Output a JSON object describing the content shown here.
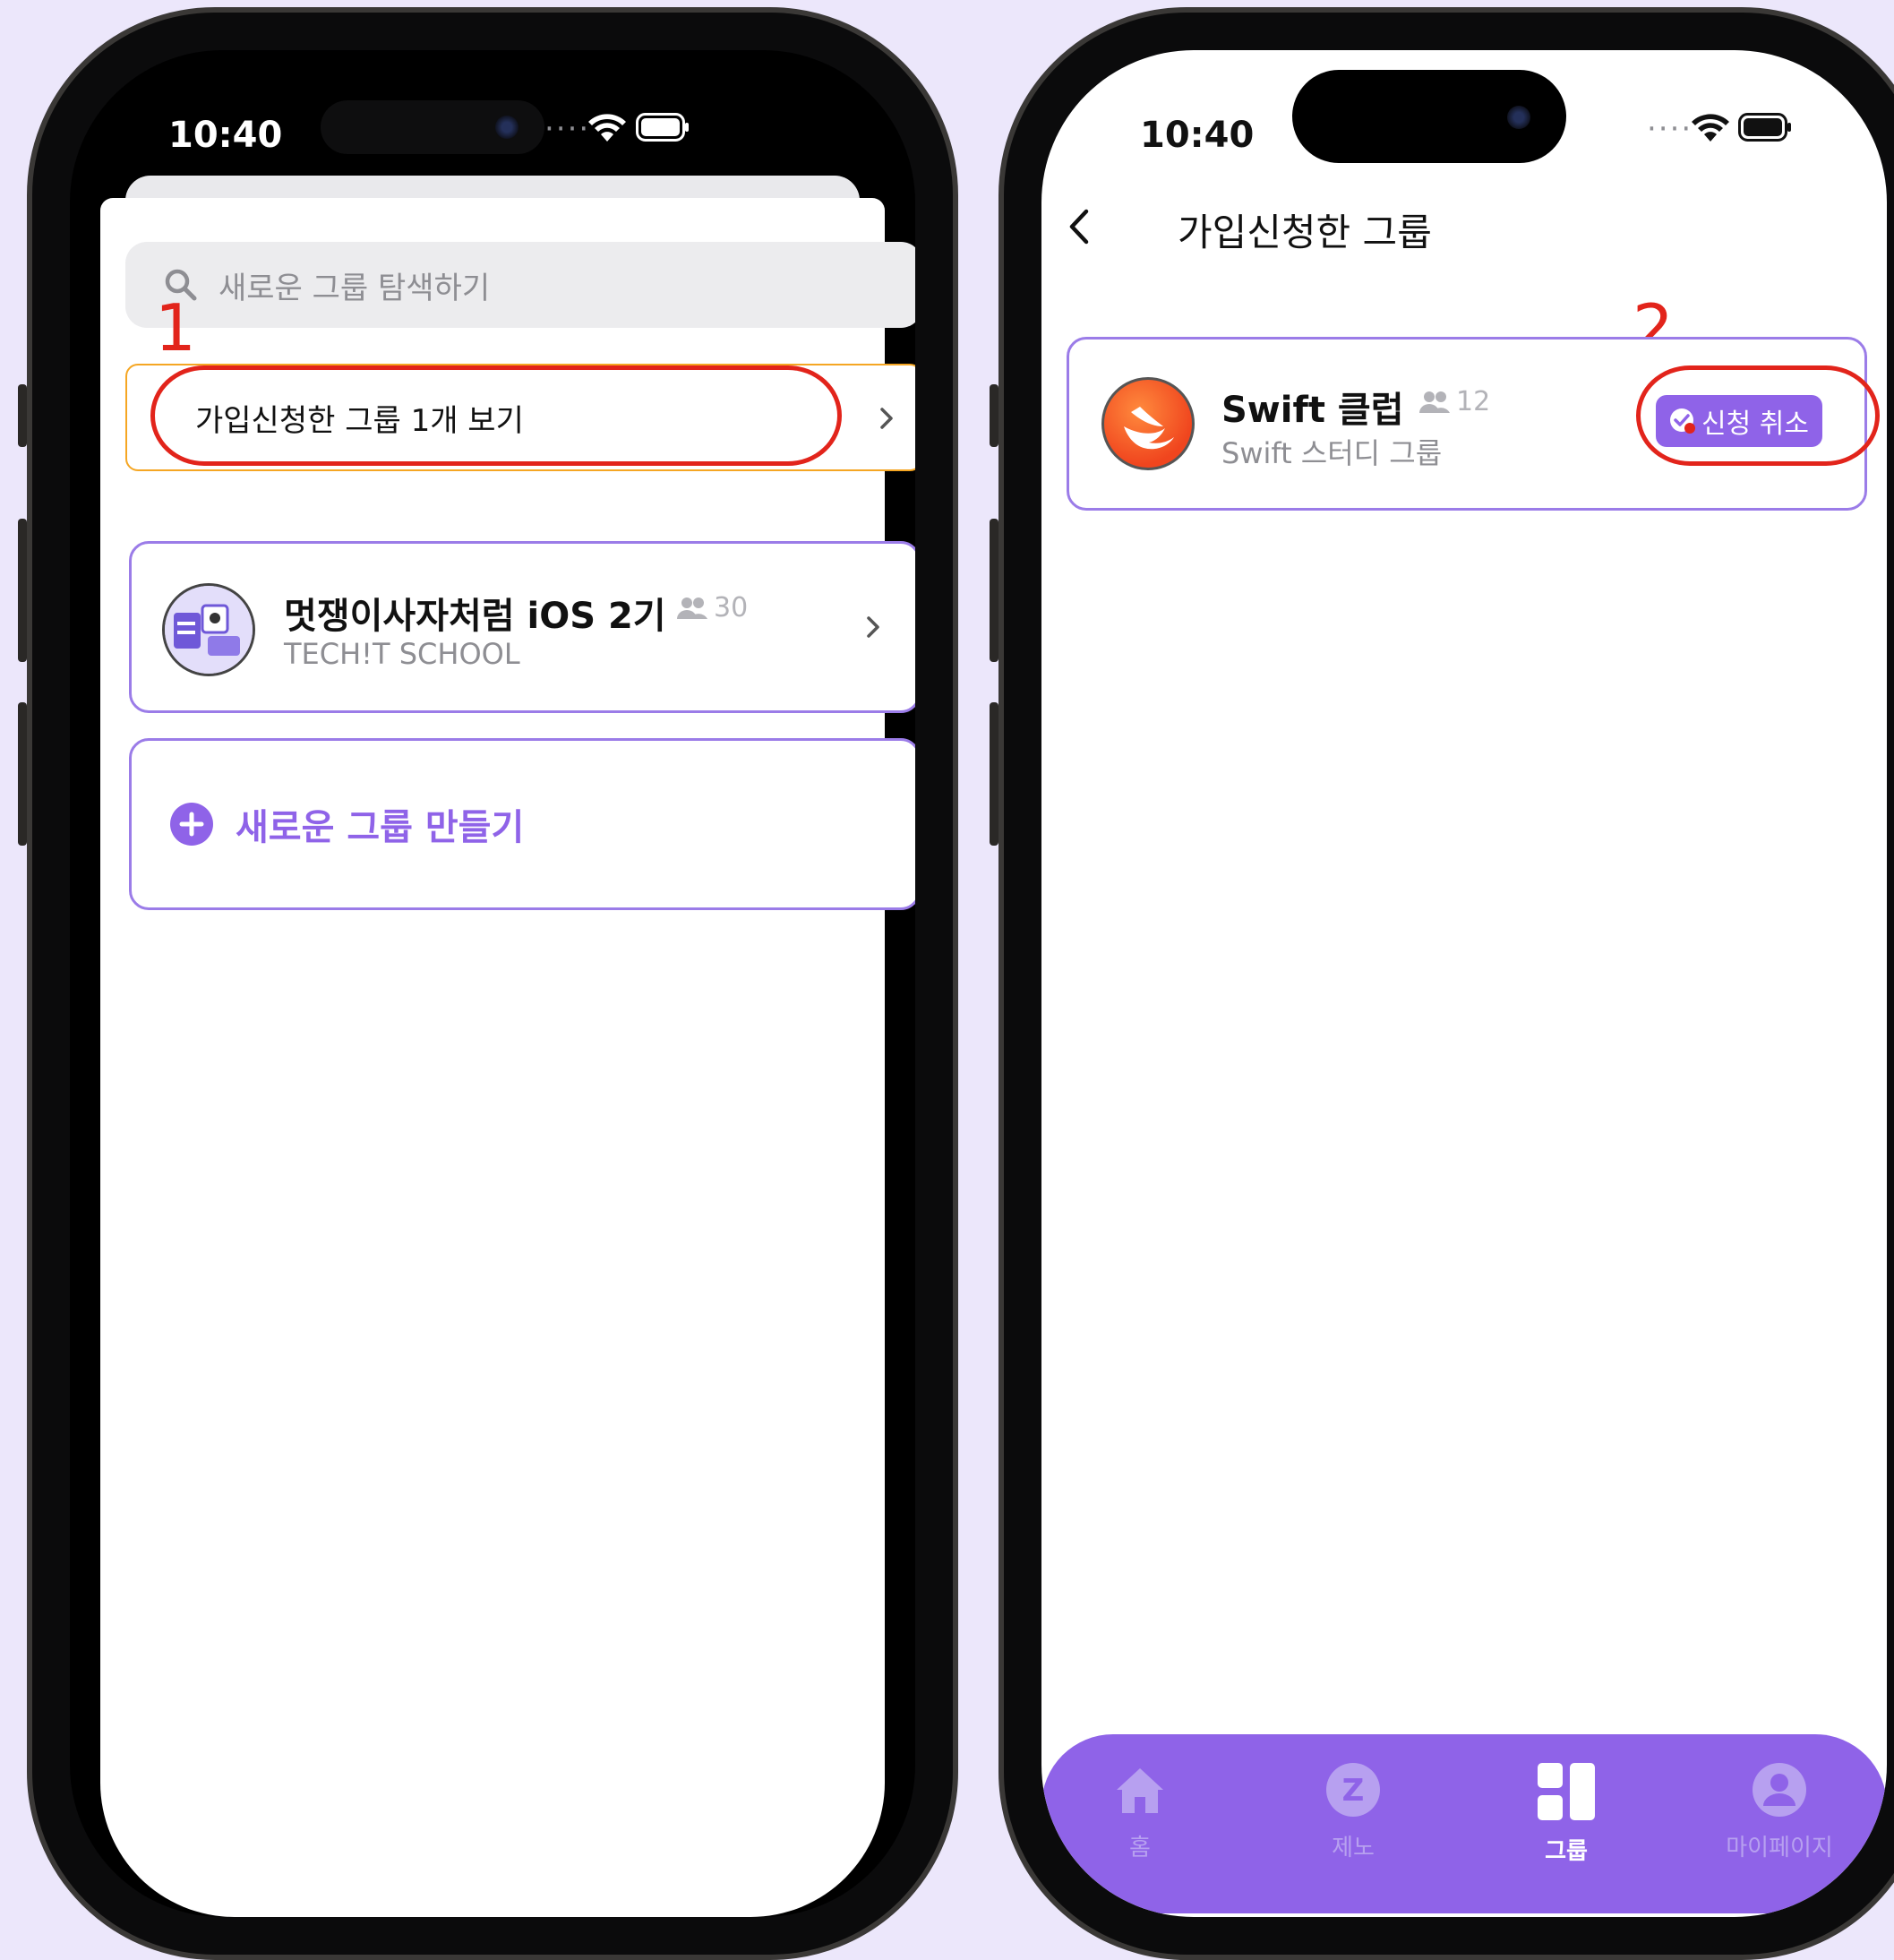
{
  "left_screen": {
    "status_time": "10:40",
    "search": {
      "placeholder": "새로운 그룹 탐색하기"
    },
    "pending": {
      "label": "가입신청한 그룹 1개 보기"
    },
    "annotation_1": "1",
    "group": {
      "name": "멋쟁이사자처럼 iOS 2기",
      "member_count": "30",
      "subtitle": "TECH!T SCHOOL"
    },
    "create": {
      "label": "새로운 그룹 만들기"
    }
  },
  "right_screen": {
    "status_time": "10:40",
    "nav_title": "가입신청한 그룹",
    "annotation_2": "2",
    "group": {
      "name": "Swift 클럽",
      "member_count": "12",
      "subtitle": "Swift 스터디 그룹",
      "cancel_label": "신청 취소"
    },
    "tabbar": {
      "items": [
        {
          "label": "홈",
          "icon": "home-icon",
          "active": false
        },
        {
          "label": "제노",
          "icon": "zeno-icon",
          "active": false
        },
        {
          "label": "그룹",
          "icon": "group-icon",
          "active": true
        },
        {
          "label": "마이페이지",
          "icon": "person-icon",
          "active": false
        }
      ]
    }
  },
  "colors": {
    "accent": "#8f63e8",
    "pending_border": "#f5a623",
    "annotation": "#e2241b",
    "background": "#ece7fb"
  }
}
